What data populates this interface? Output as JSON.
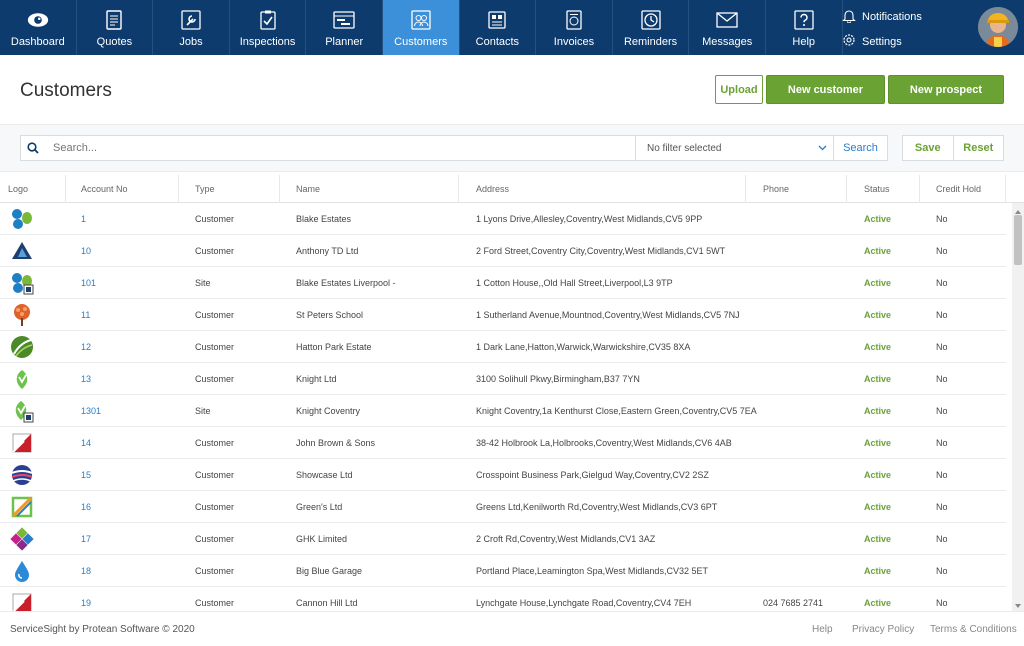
{
  "nav": {
    "items": [
      {
        "label": "Dashboard",
        "icon": "eye-icon"
      },
      {
        "label": "Quotes",
        "icon": "document-icon"
      },
      {
        "label": "Jobs",
        "icon": "wrench-icon"
      },
      {
        "label": "Inspections",
        "icon": "clipboard-check-icon"
      },
      {
        "label": "Planner",
        "icon": "planner-icon"
      },
      {
        "label": "Customers",
        "icon": "users-icon",
        "active": true
      },
      {
        "label": "Contacts",
        "icon": "contacts-icon"
      },
      {
        "label": "Invoices",
        "icon": "invoice-icon"
      },
      {
        "label": "Reminders",
        "icon": "clock-icon"
      },
      {
        "label": "Messages",
        "icon": "envelope-icon"
      },
      {
        "label": "Help",
        "icon": "question-icon"
      }
    ],
    "notifications_label": "Notifications",
    "settings_label": "Settings"
  },
  "header": {
    "title": "Customers",
    "upload_label": "Upload",
    "new_customer_label": "New customer",
    "new_prospect_label": "New prospect"
  },
  "filters": {
    "search_placeholder": "Search...",
    "filter_value": "No filter selected",
    "search_button": "Search",
    "save_label": "Save",
    "reset_label": "Reset"
  },
  "table": {
    "columns": [
      "Logo",
      "Account No",
      "Type",
      "Name",
      "Address",
      "Phone",
      "Status",
      "Credit Hold"
    ],
    "rows": [
      {
        "logo": "blue-green-blobs",
        "account": "1",
        "type": "Customer",
        "name": "Blake Estates",
        "address": "1 Lyons Drive,Allesley,Coventry,West Midlands,CV5 9PP",
        "phone": "",
        "status": "Active",
        "credit": "No"
      },
      {
        "logo": "navy-triangle",
        "account": "10",
        "type": "Customer",
        "name": "Anthony TD Ltd",
        "address": "2 Ford Street,Coventry City,Coventry,West Midlands,CV1 5WT",
        "phone": "",
        "status": "Active",
        "credit": "No"
      },
      {
        "logo": "blue-green-blobs-site",
        "account": "101",
        "type": "Site",
        "name": "Blake Estates Liverpool -",
        "address": "1 Cotton House,,Old Hall Street,Liverpool,L3 9TP",
        "phone": "",
        "status": "Active",
        "credit": "No"
      },
      {
        "logo": "orange-tree",
        "account": "11",
        "type": "Customer",
        "name": "St Peters School",
        "address": "1 Sutherland Avenue,Mountnod,Coventry,West Midlands,CV5 7NJ",
        "phone": "",
        "status": "Active",
        "credit": "No"
      },
      {
        "logo": "green-leaf-circle",
        "account": "12",
        "type": "Customer",
        "name": "Hatton Park Estate",
        "address": "1 Dark Lane,Hatton,Warwick,Warwickshire,CV35 8XA",
        "phone": "",
        "status": "Active",
        "credit": "No"
      },
      {
        "logo": "green-hand",
        "account": "13",
        "type": "Customer",
        "name": "Knight Ltd",
        "address": "3100 Solihull Pkwy,Birmingham,B37 7YN",
        "phone": "",
        "status": "Active",
        "credit": "No"
      },
      {
        "logo": "green-hand-site",
        "account": "1301",
        "type": "Site",
        "name": "Knight Coventry",
        "address": "Knight Coventry,1a Kenthurst Close,Eastern Green,Coventry,CV5 7EA",
        "phone": "",
        "status": "Active",
        "credit": "No"
      },
      {
        "logo": "red-slash",
        "account": "14",
        "type": "Customer",
        "name": "John Brown & Sons",
        "address": "38-42 Holbrook La,Holbrooks,Coventry,West Midlands,CV6 4AB",
        "phone": "",
        "status": "Active",
        "credit": "No"
      },
      {
        "logo": "blue-wave-globe",
        "account": "15",
        "type": "Customer",
        "name": "Showcase Ltd",
        "address": "Crosspoint Business Park,Gielgud Way,Coventry,CV2 2SZ",
        "phone": "",
        "status": "Active",
        "credit": "No"
      },
      {
        "logo": "orange-green-frame",
        "account": "16",
        "type": "Customer",
        "name": "Green's Ltd",
        "address": "Greens Ltd,Kenilworth Rd,Coventry,West Midlands,CV3 6PT",
        "phone": "",
        "status": "Active",
        "credit": "No"
      },
      {
        "logo": "diamond-squares",
        "account": "17",
        "type": "Customer",
        "name": "GHK Limited",
        "address": "2 Croft Rd,Coventry,West Midlands,CV1 3AZ",
        "phone": "",
        "status": "Active",
        "credit": "No"
      },
      {
        "logo": "blue-drop",
        "account": "18",
        "type": "Customer",
        "name": "Big Blue Garage",
        "address": "Portland Place,Leamington Spa,West Midlands,CV32 5ET",
        "phone": "",
        "status": "Active",
        "credit": "No"
      },
      {
        "logo": "red-slash",
        "account": "19",
        "type": "Customer",
        "name": "Cannon Hill Ltd",
        "address": "Lynchgate House,Lynchgate Road,Coventry,CV4 7EH",
        "phone": "024 7685 2741",
        "status": "Active",
        "credit": "No"
      }
    ]
  },
  "footer": {
    "copyright": "ServiceSight by Protean Software © 2020",
    "help": "Help",
    "privacy": "Privacy Policy",
    "terms": "Terms & Conditions"
  },
  "colors": {
    "nav_bg": "#0d3b6e",
    "nav_active": "#3c8fd9",
    "accent_green": "#6ba234",
    "link_blue": "#2a7ec8"
  }
}
